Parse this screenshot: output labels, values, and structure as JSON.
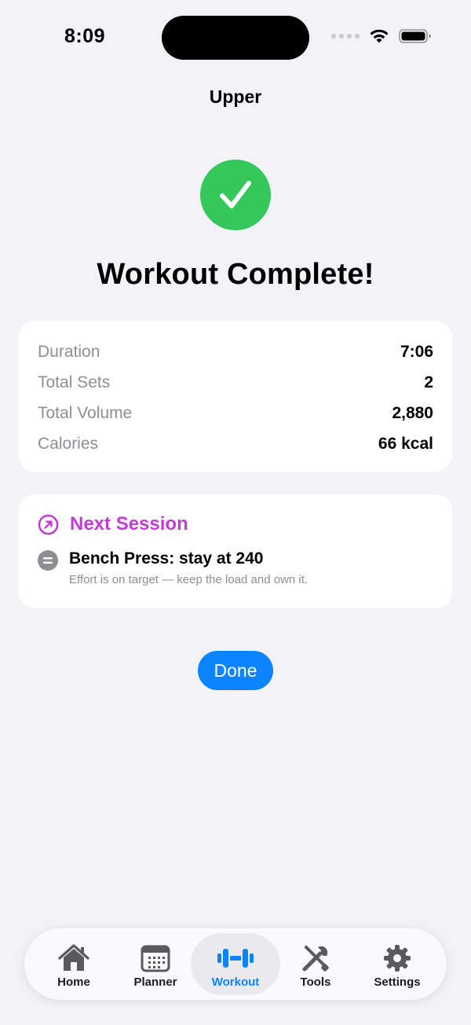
{
  "status_bar": {
    "time": "8:09"
  },
  "nav": {
    "title": "Upper"
  },
  "headline": "Workout Complete!",
  "stats": [
    {
      "label": "Duration",
      "value": "7:06"
    },
    {
      "label": "Total Sets",
      "value": "2"
    },
    {
      "label": "Total Volume",
      "value": "2,880"
    },
    {
      "label": "Calories",
      "value": "66 kcal"
    }
  ],
  "next_session": {
    "title": "Next Session",
    "icon": "arrow-up-right-circle-icon",
    "item": {
      "icon": "minus-circle-icon",
      "title": "Bench Press: stay at 240",
      "subtitle": "Effort is on target — keep the load and own it."
    }
  },
  "done_label": "Done",
  "tabs": [
    {
      "label": "Home",
      "icon": "house-icon"
    },
    {
      "label": "Planner",
      "icon": "calendar-icon"
    },
    {
      "label": "Workout",
      "icon": "dumbbell-icon",
      "active": true
    },
    {
      "label": "Tools",
      "icon": "wrench-screwdriver-icon"
    },
    {
      "label": "Settings",
      "icon": "gear-icon"
    }
  ],
  "colors": {
    "background": "#f2f2f7",
    "success": "#34c759",
    "accent": "#0a84ff",
    "next_session": "#c33bd6",
    "secondary_text": "#8e8e93"
  }
}
